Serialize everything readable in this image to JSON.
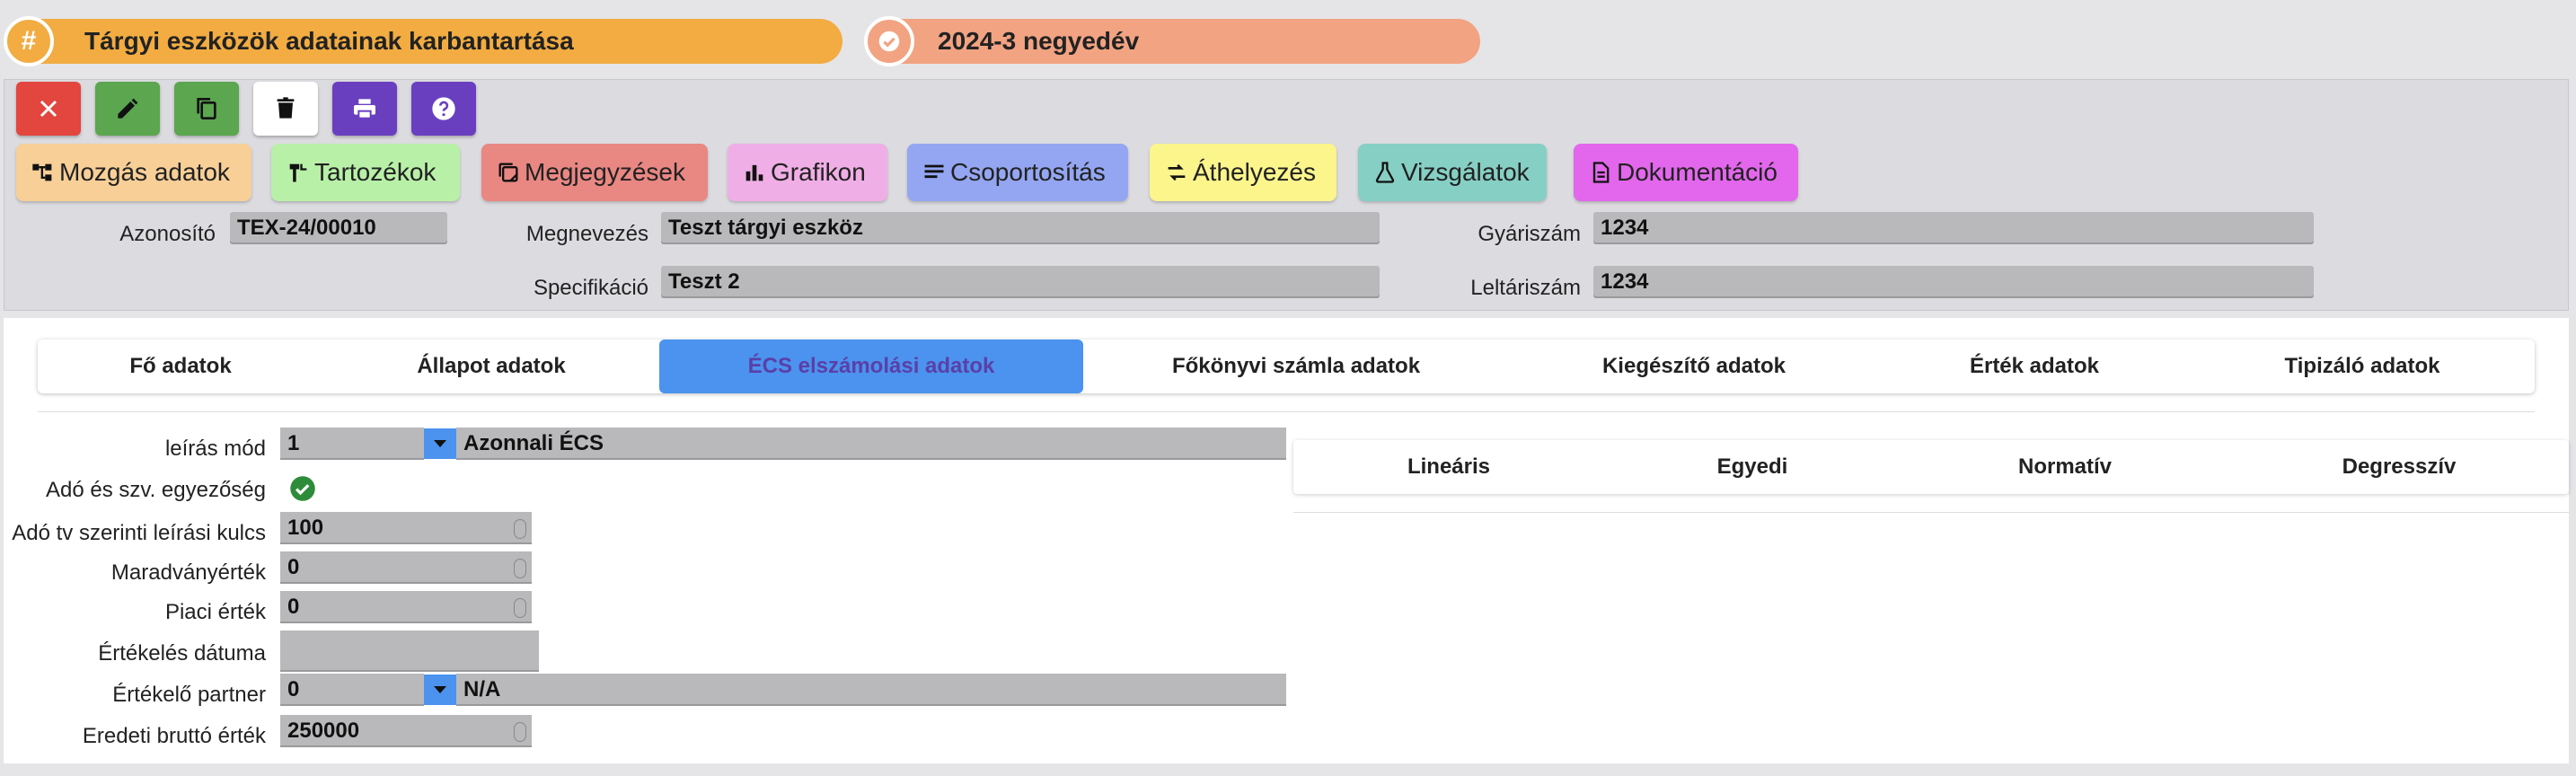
{
  "header": {
    "title": "Tárgyi eszközök adatainak karbantartása",
    "title_badge": "#",
    "period": "2024-3 negyedév"
  },
  "toolbar": {
    "buttons": [
      {
        "name": "close",
        "icon": "close-icon",
        "color": "#e2463f"
      },
      {
        "name": "edit",
        "icon": "pencil-icon",
        "color": "#5ba64f"
      },
      {
        "name": "copy",
        "icon": "copy-icon",
        "color": "#5ba64f"
      },
      {
        "name": "delete",
        "icon": "trash-icon",
        "color": "#ffffff"
      },
      {
        "name": "print",
        "icon": "print-icon",
        "color": "#6a3fbf"
      },
      {
        "name": "help",
        "icon": "help-icon",
        "color": "#6a3fbf"
      }
    ],
    "actions": [
      {
        "label": "Mozgás adatok",
        "icon": "movement-icon",
        "color": "#f7cf97"
      },
      {
        "label": "Tartozékok",
        "icon": "tools-icon",
        "color": "#b8f0a8"
      },
      {
        "label": "Megjegyzések",
        "icon": "notes-icon",
        "color": "#e98783"
      },
      {
        "label": "Grafikon",
        "icon": "chart-icon",
        "color": "#f0aee6"
      },
      {
        "label": "Csoportosítás",
        "icon": "list-icon",
        "color": "#94a6f2"
      },
      {
        "label": "Áthelyezés",
        "icon": "transfer-icon",
        "color": "#fbf58c"
      },
      {
        "label": "Vizsgálatok",
        "icon": "flask-icon",
        "color": "#86cfc4"
      },
      {
        "label": "Dokumentáció",
        "icon": "document-icon",
        "color": "#e267ec"
      }
    ]
  },
  "info": {
    "azonosito_label": "Azonosító",
    "azonosito_value": "TEX-24/00010",
    "megnevezes_label": "Megnevezés",
    "megnevezes_value": "Teszt tárgyi eszköz",
    "gyariszam_label": "Gyáriszám",
    "gyariszam_value": "1234",
    "specifikacio_label": "Specifikáció",
    "specifikacio_value": "Teszt 2",
    "leltariszam_label": "Leltáriszám",
    "leltariszam_value": "1234"
  },
  "tabs": [
    "Fő adatok",
    "Állapot adatok",
    "ÉCS elszámolási adatok",
    "Főkönyvi számla adatok",
    "Kiegészítő adatok",
    "Érték adatok",
    "Tipizáló adatok"
  ],
  "active_tab": "ÉCS elszámolási adatok",
  "form": {
    "leiras_mod_label": "leírás mód",
    "leiras_mod_code": "1",
    "leiras_mod_text": "Azonnali ÉCS",
    "ado_szv_label": "Adó és szv. egyezőség",
    "ado_tv_label": "Adó tv szerinti leírási kulcs",
    "ado_tv_value": "100",
    "maradvany_label": "Maradványérték",
    "maradvany_value": "0",
    "piaci_label": "Piaci érték",
    "piaci_value": "0",
    "ertekeles_datum_label": "Értékelés dátuma",
    "ertekeles_datum_value": "",
    "ertekelo_partner_label": "Értékelő partner",
    "ertekelo_partner_code": "0",
    "ertekelo_partner_text": "N/A",
    "eredeti_brutto_label": "Eredeti bruttó érték",
    "eredeti_brutto_value": "250000"
  },
  "subtabs": [
    "Lineáris",
    "Egyedi",
    "Normatív",
    "Degresszív"
  ]
}
